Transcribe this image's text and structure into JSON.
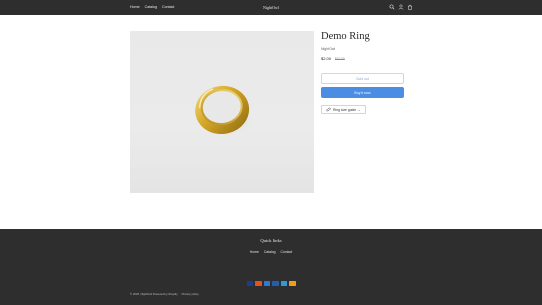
{
  "header": {
    "nav": [
      "Home",
      "Catalog",
      "Contact"
    ],
    "brand": "NightOwl",
    "icons": [
      "search-icon",
      "account-icon",
      "cart-icon"
    ]
  },
  "product": {
    "title": "Demo Ring",
    "vendor": "NightOwl",
    "price": "$2.00",
    "compare_price": "$10.00",
    "sold_out_label": "Sold out",
    "buy_label": "Buy it now",
    "size_guide_label": "Ring size guide →",
    "image": "gold-ring-image"
  },
  "footer": {
    "heading": "Quick links",
    "links": [
      "Home",
      "Catalog",
      "Contact"
    ],
    "payments": [
      {
        "name": "visa-icon",
        "color": "#1a3e8f"
      },
      {
        "name": "mastercard-icon",
        "color": "#e2531b"
      },
      {
        "name": "amex-icon",
        "color": "#2a7bd1"
      },
      {
        "name": "paypal-icon",
        "color": "#1f5fb0"
      },
      {
        "name": "applepay-icon",
        "color": "#2c9bd8"
      },
      {
        "name": "discover-icon",
        "color": "#f39a1c"
      }
    ],
    "copyright": "© 2025, NightOwl Powered by Shopify",
    "privacy": "Privacy policy"
  }
}
